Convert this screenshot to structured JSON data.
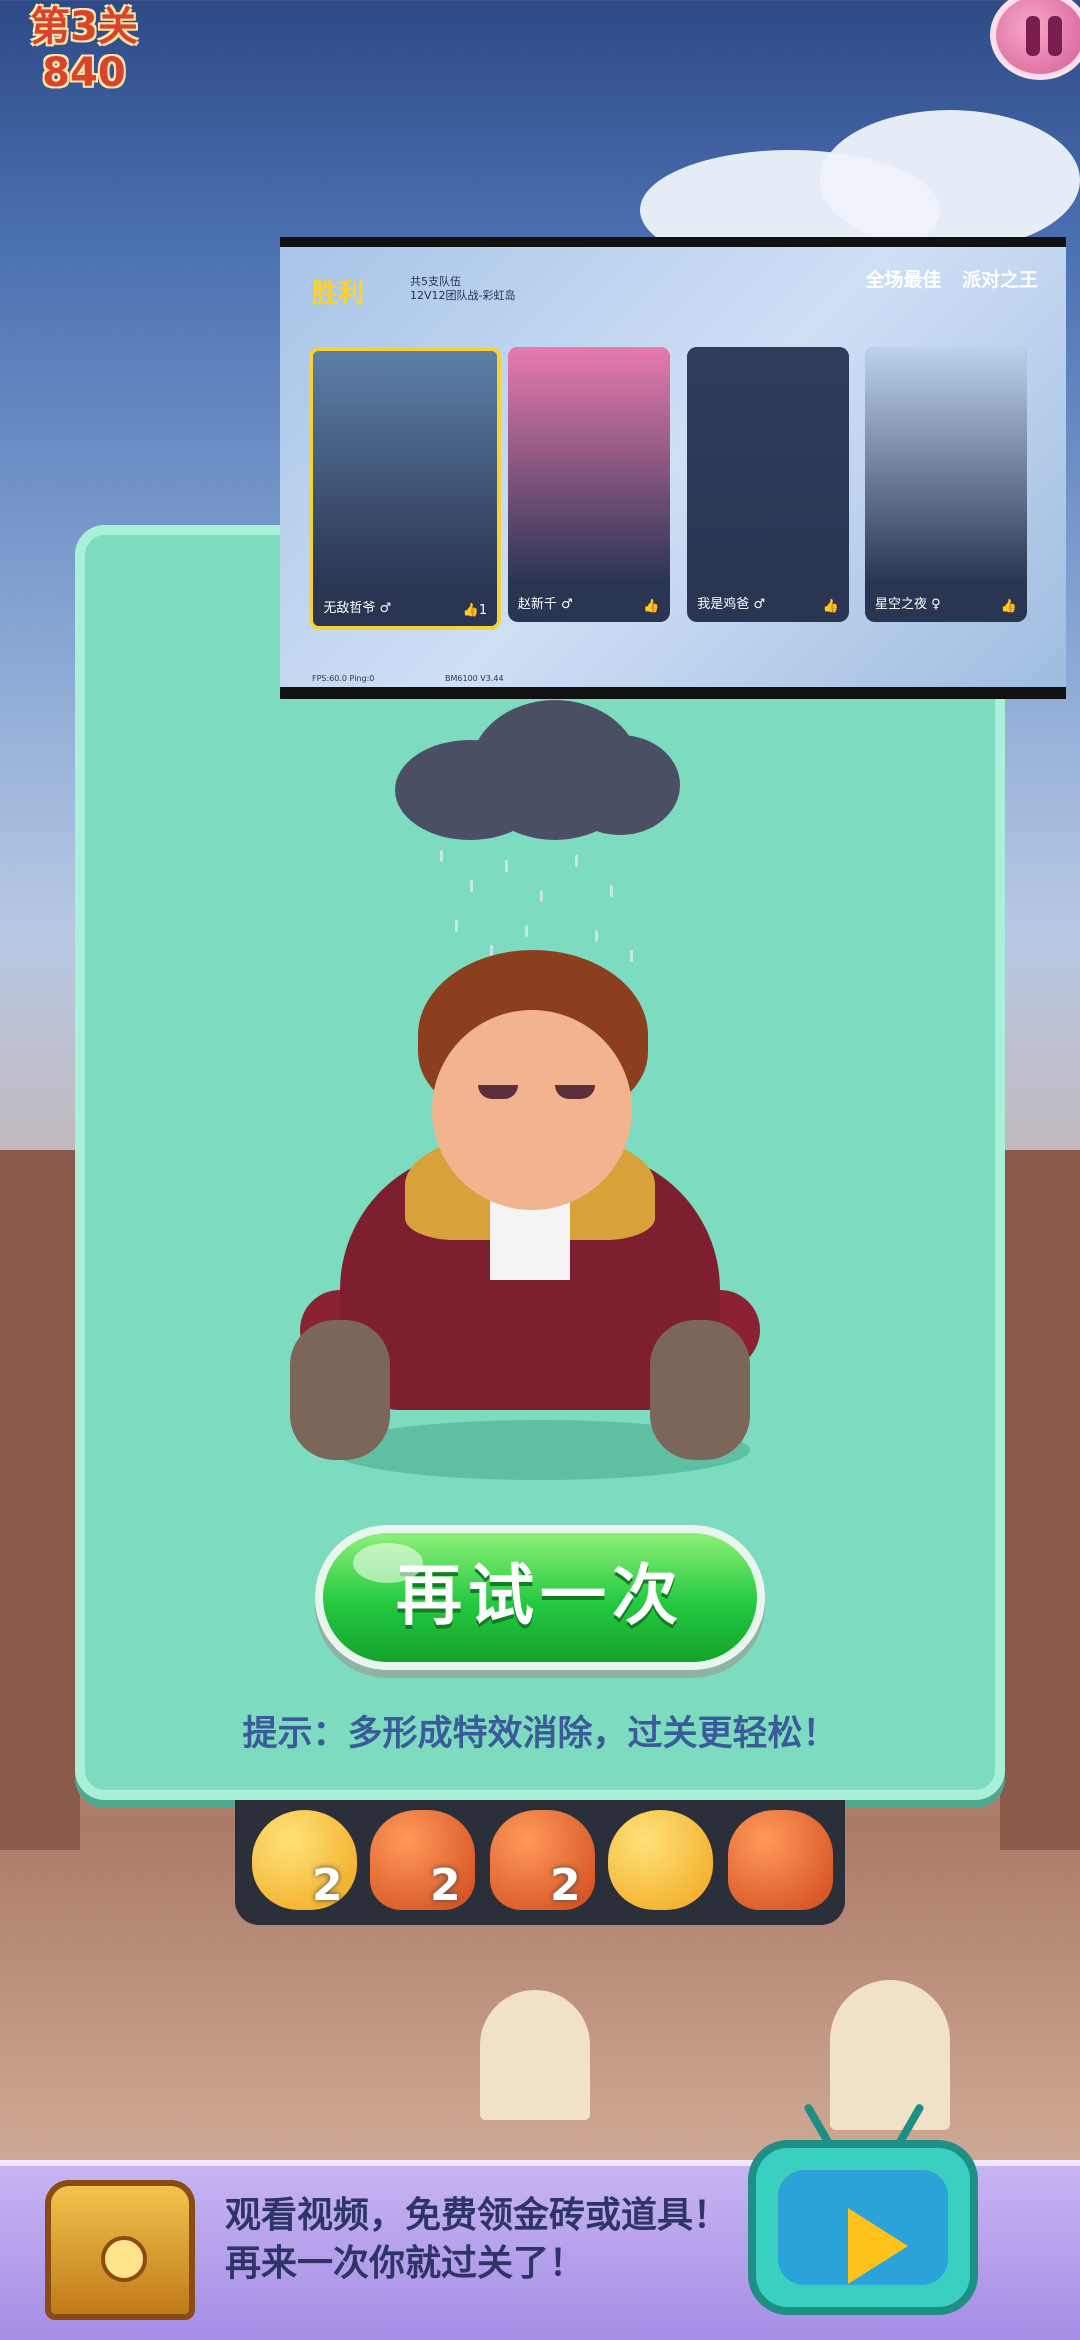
{
  "hud": {
    "level_label": "第3关",
    "score": "840"
  },
  "overlay": {
    "victory": "胜利",
    "sub_line1": "共5支队伍",
    "sub_line2": "12V12团队战-彩虹岛",
    "header_right": [
      "全场最佳",
      "派对之王"
    ],
    "cards": [
      {
        "name": "无敌哲爷 ♂",
        "likes": "👍1",
        "color": "#5d7fa6"
      },
      {
        "name": "赵新千 ♂",
        "likes": "👍",
        "color": "#e87ab0"
      },
      {
        "name": "我是鸡爸 ♂",
        "likes": "👍",
        "color": "#2f3c5a"
      },
      {
        "name": "星空之夜 ♀",
        "likes": "👍",
        "color": "#bcd3ec"
      }
    ],
    "footer_left": "FPS:60.0 Ping:0",
    "footer_right": "BM6100 V3.44"
  },
  "retry_label": "再试一次",
  "hint": "提示：多形成特效消除，过关更轻松！",
  "candies": [
    {
      "type": "heart",
      "count": "2"
    },
    {
      "type": "jelly",
      "count": "2"
    },
    {
      "type": "jelly",
      "count": "2"
    },
    {
      "type": "heart",
      "count": ""
    },
    {
      "type": "jelly",
      "count": ""
    }
  ],
  "banner": {
    "line1": "观看视频，免费领金砖或道具！",
    "line2": "再来一次你就过关了！"
  }
}
